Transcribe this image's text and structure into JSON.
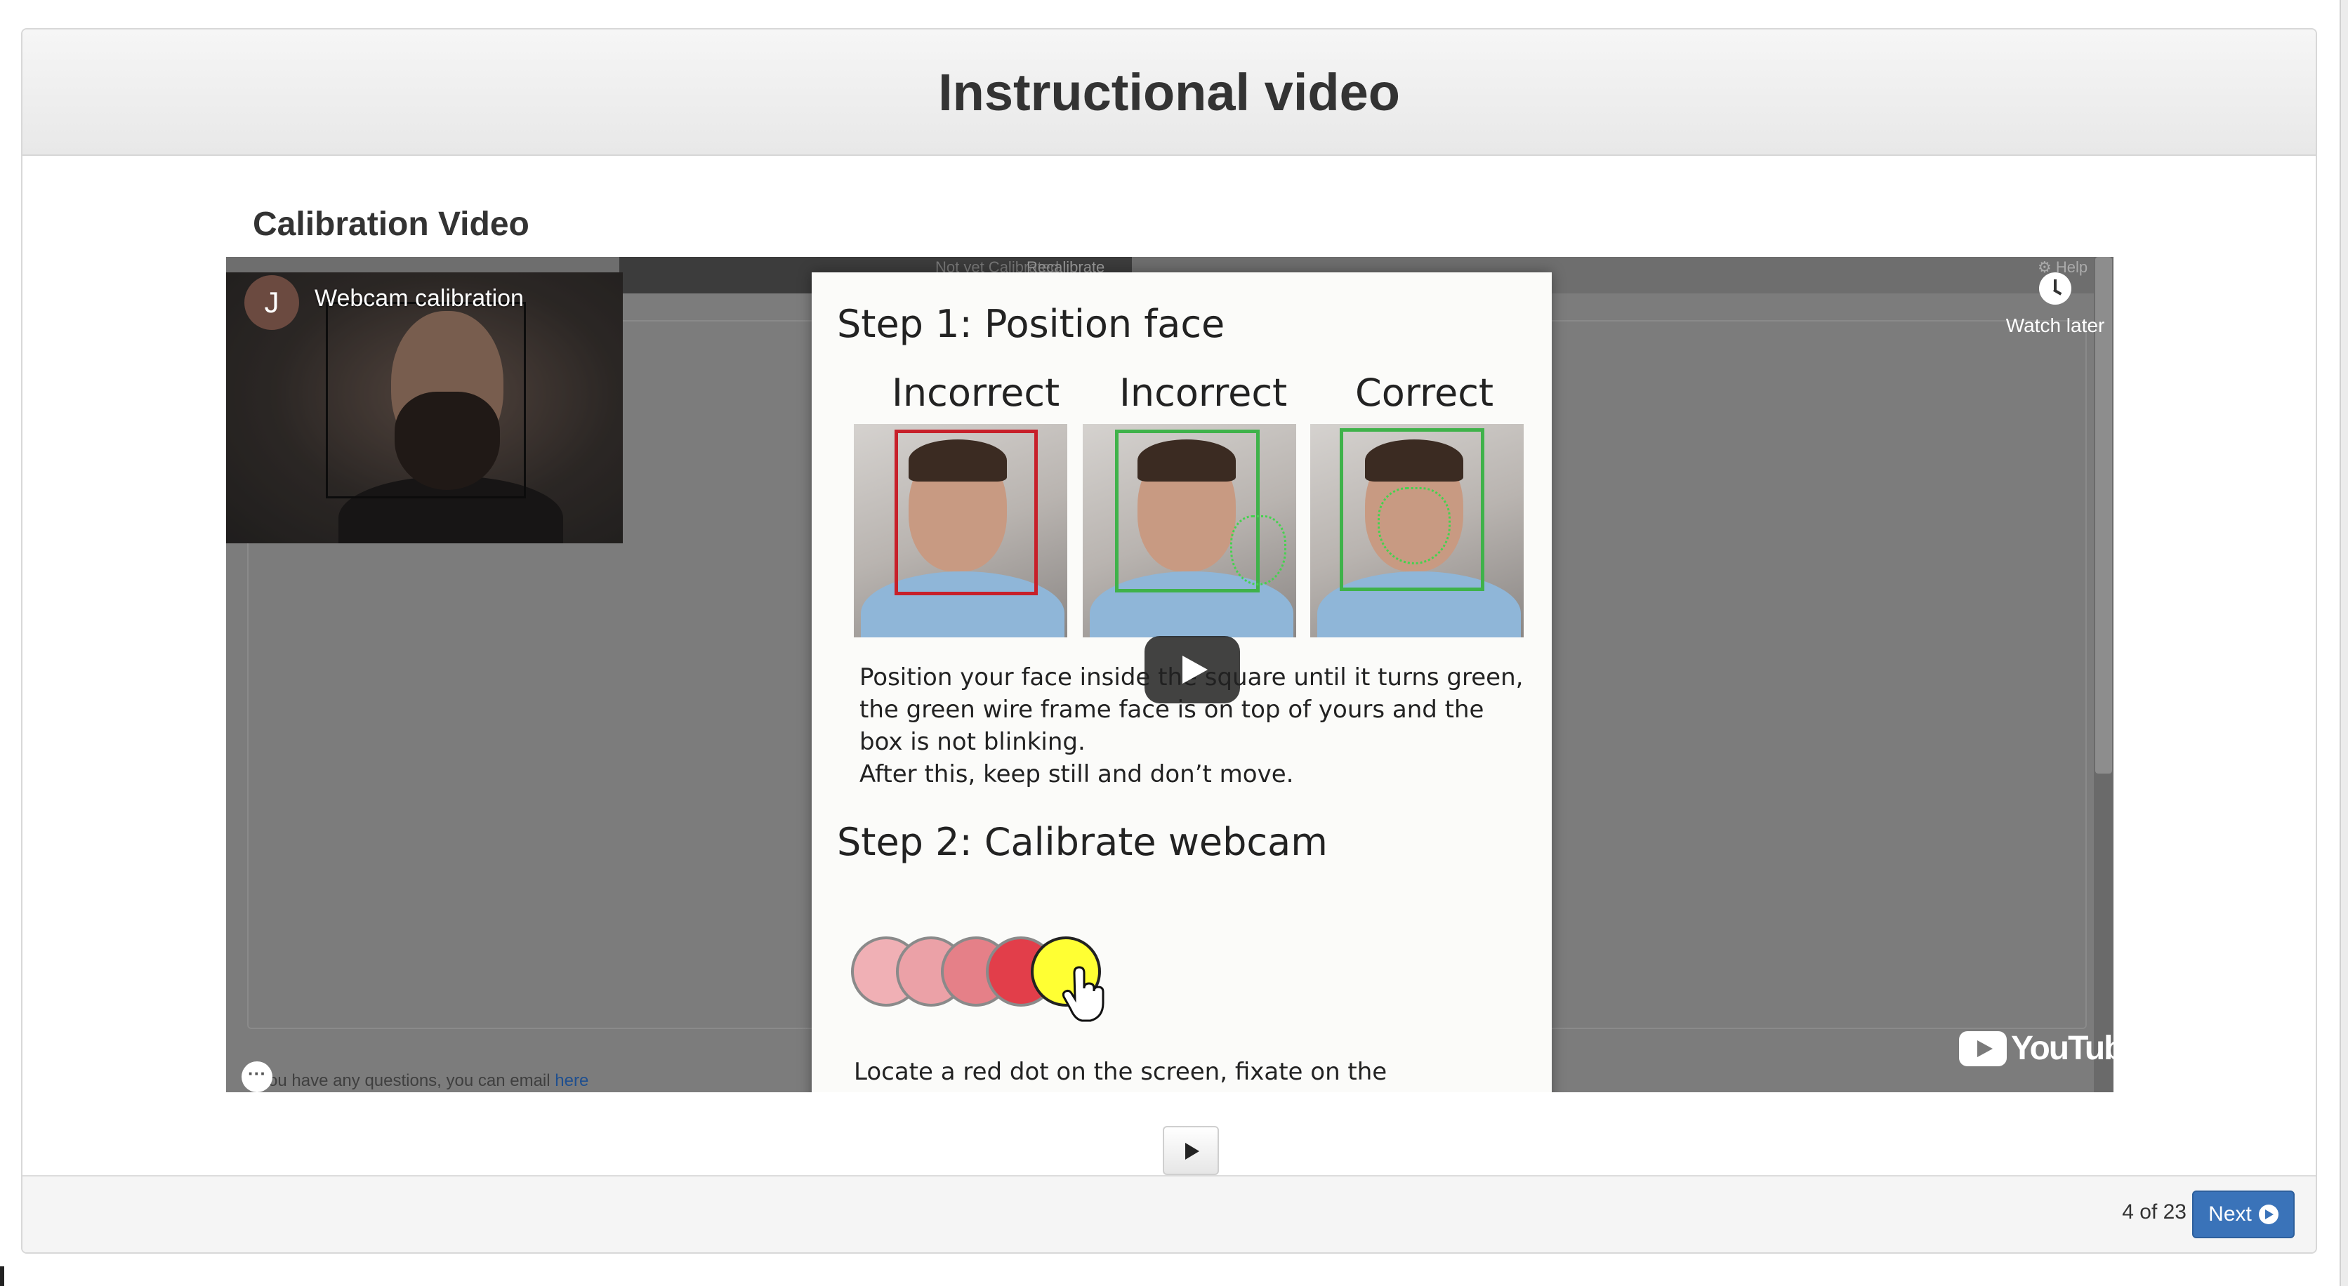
{
  "header": {
    "title": "Instructional video"
  },
  "section": {
    "heading": "Calibration Video"
  },
  "video": {
    "channel_initial": "J",
    "title": "Webcam calibration",
    "watch_later_label": "Watch later",
    "youtube_label": "YouTube",
    "more_label": "···",
    "background": {
      "tab_status": "Not yet Calibrated",
      "tab_recalibrate": "Recalibrate",
      "help": "⚙ Help",
      "email_text": "If you have any questions, you can email ",
      "email_link": "here"
    },
    "slide": {
      "step1_title": "Step 1: Position face",
      "col1_label": "Incorrect",
      "col2_label": "Incorrect",
      "col3_label": "Correct",
      "step1_text_a": "Position your face inside the square until it turns green, the green wire frame face is on top of yours and the box is not blinking.",
      "step1_text_b": "After this, keep still and don’t move.",
      "step2_title": "Step 2: Calibrate webcam",
      "step2_text": "Locate a red dot on the screen, fixate on the"
    }
  },
  "footer": {
    "page_indicator": "4 of 23",
    "next_label": "Next"
  },
  "colors": {
    "next_button": "#3a73b9",
    "correct_box": "#3fb24a",
    "incorrect_box": "#c7202a",
    "target_dot": "#ffff33"
  }
}
